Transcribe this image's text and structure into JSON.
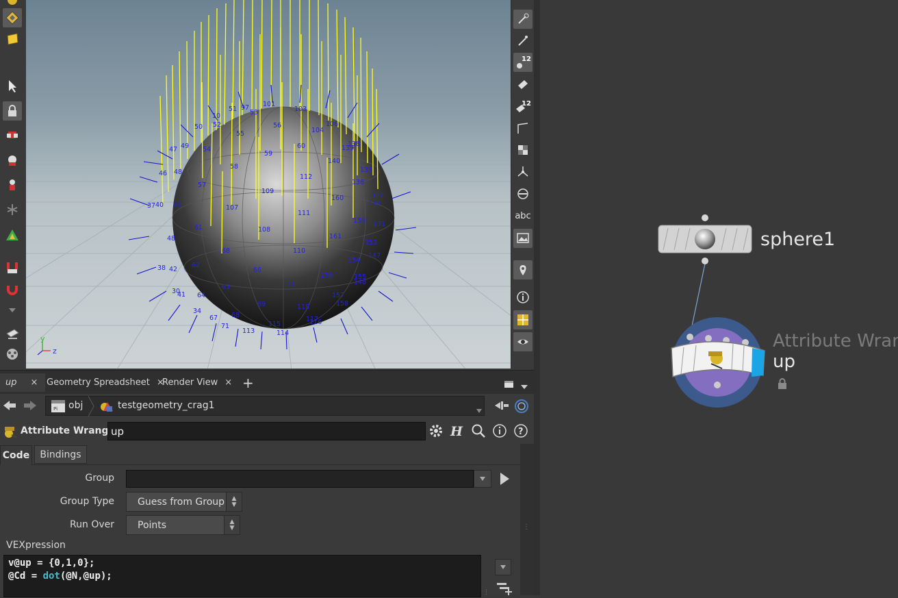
{
  "viewport": {
    "axis_y": "y",
    "axis_z": "z",
    "point_numbers": [
      "51",
      "97",
      "101",
      "103",
      "10",
      "53",
      "106",
      "50",
      "52",
      "56",
      "104",
      "49",
      "55",
      "138",
      "47",
      "54",
      "139",
      "60",
      "59",
      "140",
      "48",
      "58",
      "135",
      "46",
      "112",
      "57",
      "136",
      "132",
      "37",
      "40",
      "44",
      "109",
      "160",
      "133",
      "107",
      "111",
      "159",
      "131",
      "61",
      "108",
      "161",
      "153",
      "48",
      "68",
      "110",
      "147",
      "154",
      "38",
      "42",
      "62",
      "66",
      "156",
      "155",
      "148",
      "63",
      "70",
      "30",
      "41",
      "64",
      "157",
      "69",
      "118",
      "158",
      "34",
      "67",
      "68",
      "117",
      "116",
      "71",
      "115",
      "113",
      "114"
    ]
  },
  "tabs": [
    {
      "label": "up",
      "active": true
    },
    {
      "label": "Geometry Spreadsheet",
      "active": false
    },
    {
      "label": "Render View",
      "active": false
    }
  ],
  "tab_close_glyph": "×",
  "add_tab_glyph": "+",
  "path": {
    "root": "obj",
    "node": "testgeometry_crag1"
  },
  "node_header": {
    "type_label": "Attribute Wrangle",
    "name_value": "up"
  },
  "param_tabs": {
    "code": "Code",
    "bindings": "Bindings"
  },
  "params": {
    "group_label": "Group",
    "group_value": "",
    "group_type_label": "Group Type",
    "group_type_value": "Guess from Group",
    "run_over_label": "Run Over",
    "run_over_value": "Points",
    "vex_label": "VEXpression",
    "code_line1": "v@up = {0,1,0};",
    "code_line2_a": "@Cd = ",
    "code_line2_fn": "dot",
    "code_line2_b": "(@N,@up);"
  },
  "right_toolbar": {
    "text_tool": "abc",
    "badge_1": "12",
    "badge_2": "12"
  },
  "network": {
    "sphere_node_name": "sphere1",
    "wrangle_node_type": "Attribute Wrangle",
    "wrangle_node_name": "up"
  },
  "colors": {
    "normals": "#ffff1a",
    "point_numbers": "#2323e0",
    "wrangle_accent": "#1aa6e6",
    "wrangle_ring": "#3d5a8c",
    "wrangle_inner": "#8f72c9"
  }
}
